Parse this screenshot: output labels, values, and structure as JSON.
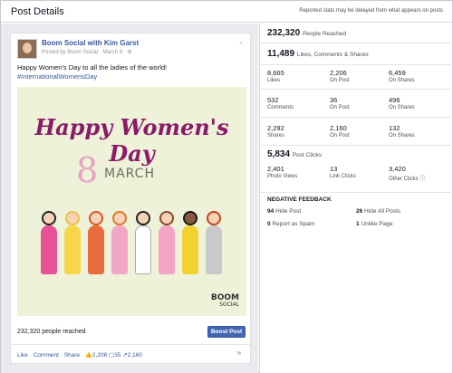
{
  "header": {
    "title": "Post Details",
    "note": "Reported stats may be delayed from what appears on posts"
  },
  "post": {
    "page_name": "Boom Social with Kim Garst",
    "posted_by": "Posted by Boom Social",
    "date": "March 8",
    "message": "Happy Women's Day to all the ladies of the world!",
    "hashtag": "#InternationalWomensDay",
    "image": {
      "line1": "Happy Women's Day",
      "number": "8",
      "month": "MARCH",
      "logo_top": "BOOM",
      "logo_bottom": "SOCIAL"
    },
    "reach_text": "232,320 people reached",
    "boost_label": "Boost Post",
    "actions": {
      "like": "Like",
      "comment": "Comment",
      "share": "Share",
      "likes_count": "2,206",
      "comments_count": "35",
      "shares_count": "2,160"
    }
  },
  "stats": {
    "reach": {
      "value": "232,320",
      "label": "People Reached"
    },
    "engagement": {
      "value": "11,489",
      "label": "Likes, Comments & Shares"
    },
    "likes": [
      {
        "value": "8,665",
        "label": "Likes"
      },
      {
        "value": "2,206",
        "label": "On Post"
      },
      {
        "value": "6,459",
        "label": "On Shares"
      }
    ],
    "comments": [
      {
        "value": "532",
        "label": "Comments"
      },
      {
        "value": "36",
        "label": "On Post"
      },
      {
        "value": "496",
        "label": "On Shares"
      }
    ],
    "shares": [
      {
        "value": "2,292",
        "label": "Shares"
      },
      {
        "value": "2,160",
        "label": "On Post"
      },
      {
        "value": "132",
        "label": "On Shares"
      }
    ],
    "post_clicks": {
      "value": "5,834",
      "label": "Post Clicks"
    },
    "clicks": [
      {
        "value": "2,401",
        "label": "Photo Views"
      },
      {
        "value": "13",
        "label": "Link Clicks"
      },
      {
        "value": "3,420",
        "label": "Other Clicks"
      }
    ],
    "negative": {
      "title": "NEGATIVE FEEDBACK",
      "items": [
        {
          "value": "94",
          "label": "Hide Post"
        },
        {
          "value": "26",
          "label": "Hide All Posts"
        },
        {
          "value": "0",
          "label": "Report as Spam"
        },
        {
          "value": "1",
          "label": "Unlike Page"
        }
      ]
    }
  }
}
